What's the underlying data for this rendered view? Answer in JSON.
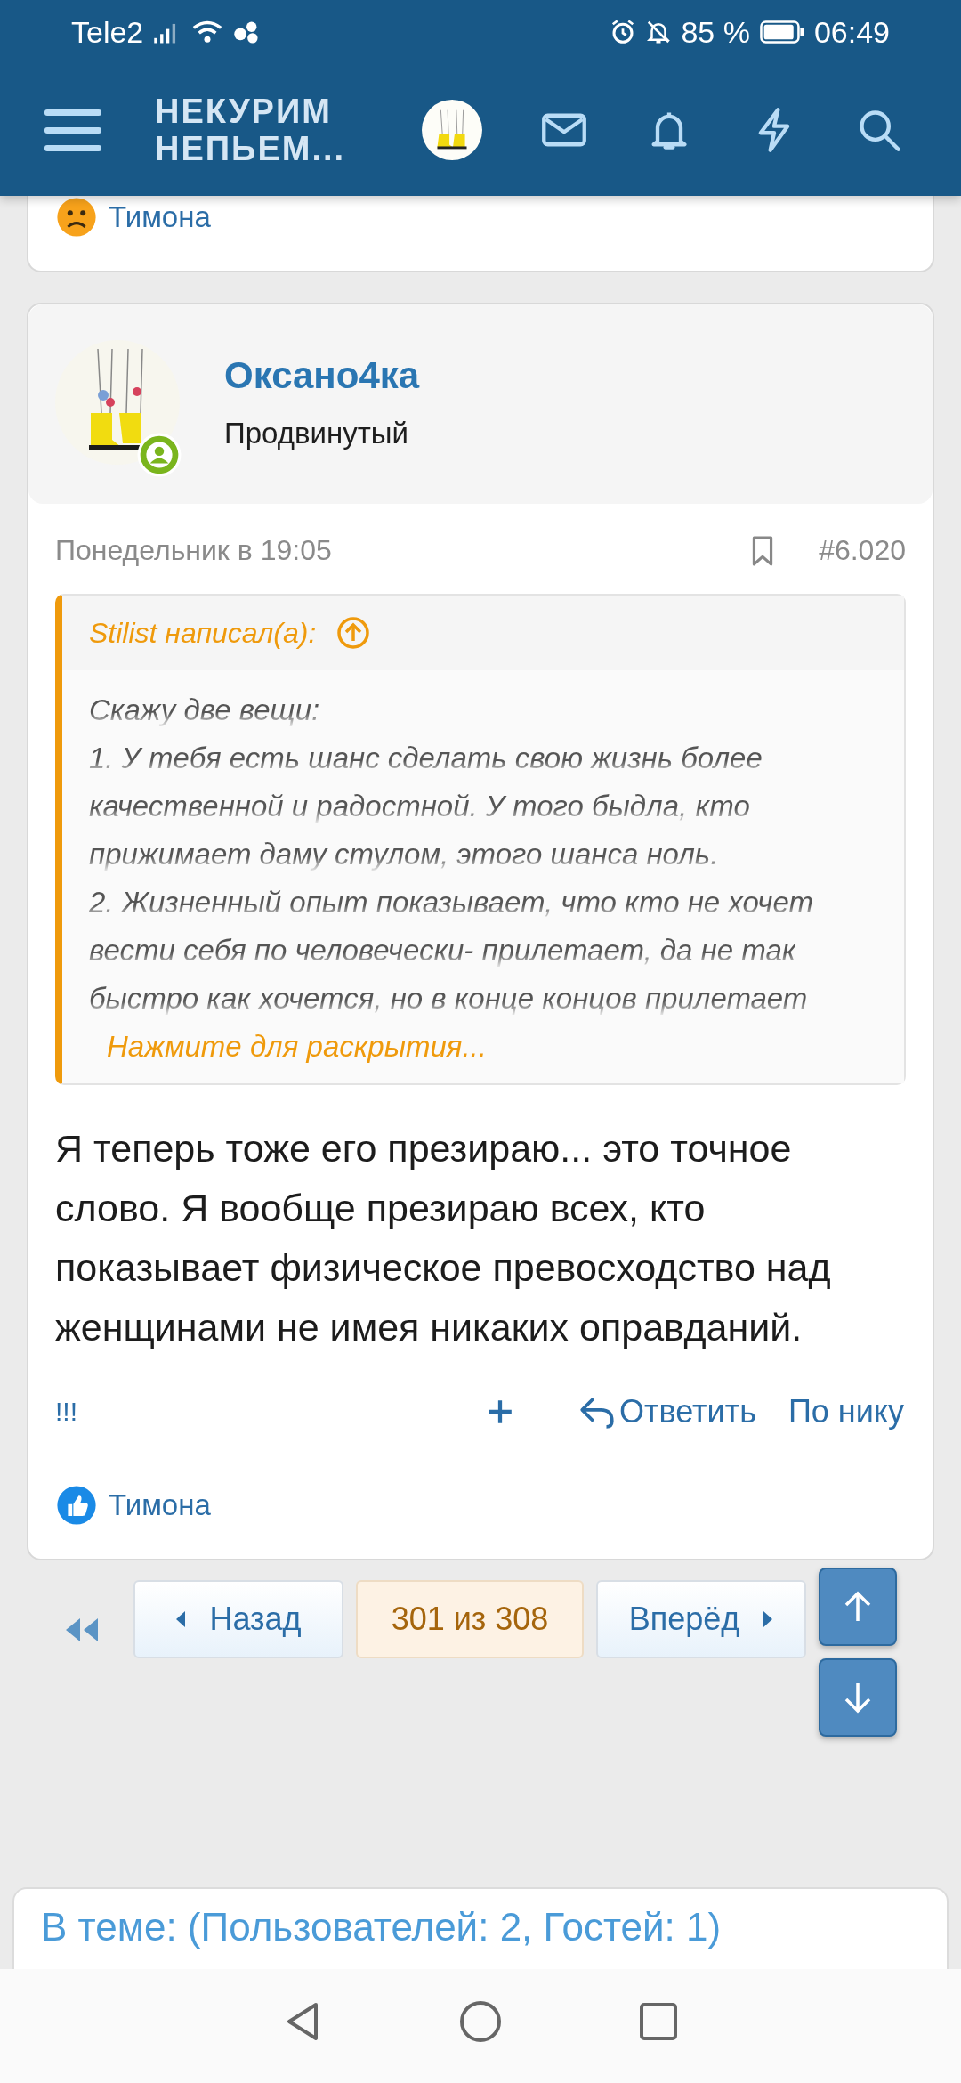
{
  "status_bar": {
    "carrier": "Tele2",
    "battery": "85 %",
    "time": "06:49"
  },
  "header": {
    "logo": [
      "НЕКУРИМ",
      "НЕПЬЕМ..."
    ]
  },
  "previous_post": {
    "reactions": [
      {
        "kind": "sad",
        "user": "Тимона"
      }
    ]
  },
  "post": {
    "author": "Оксано4ка",
    "rank": "Продвинутый",
    "online": true,
    "date": "Понедельник в 19:05",
    "number": "#6.020",
    "quote": {
      "author": "Stilist написал(а):",
      "text": "Скажу две вещи:\n1. У тебя есть шанс сделать свою жизнь более качественной и радостной. У того быдла, кто прижимает даму стулом, этого шанса ноль.\n2. Жизненный опыт показывает, что кто не хочет вести себя по человечески- прилетает, да не так быстро как хочется, но в конце концов прилетает",
      "expand": "Нажмите для раскрытия..."
    },
    "body": "Я теперь тоже его презираю... это точное слово. Я вообще презираю всех, кто показывает физическое превосходство над женщинами не имея никаких оправданий.",
    "actions": {
      "left": "!!!",
      "reply": "Ответить",
      "by_nick": "По нику"
    },
    "reactions": [
      {
        "kind": "like",
        "user": "Тимона"
      }
    ]
  },
  "pagination": {
    "prev": "Назад",
    "current": "301 из 308",
    "next": "Вперёд"
  },
  "online_block": {
    "title": "В теме: (Пользователей: 2, Гостей: 1)"
  }
}
